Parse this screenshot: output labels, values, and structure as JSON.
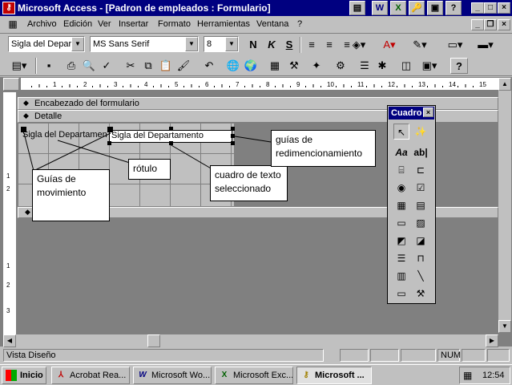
{
  "window": {
    "title": "Microsoft Access - [Padron de empleados : Formulario]",
    "app_icon": "access-key-icon",
    "title_apps": [
      "W",
      "X",
      "🔑",
      "?"
    ]
  },
  "menu": {
    "items": [
      {
        "label": "Archivo"
      },
      {
        "label": "Edición"
      },
      {
        "label": "Ver"
      },
      {
        "label": "Insertar"
      },
      {
        "label": "Formato"
      },
      {
        "label": "Herramientas"
      },
      {
        "label": "Ventana"
      },
      {
        "label": "?"
      }
    ]
  },
  "format_toolbar": {
    "object_combo": "Sigla del Depart",
    "font_combo": "MS Sans Serif",
    "size_combo": "8",
    "bold": "N",
    "italic": "K",
    "underline": "S"
  },
  "form_design": {
    "header_section": "Encabezado del formulario",
    "detail_section": "Detalle",
    "label_control_text": "Sigla del Departamen",
    "textbox_control_text": "Sigla del Departamento",
    "ruler_top_numbers": [
      "1",
      "2",
      "3",
      "4",
      "5",
      "6",
      "7",
      "8",
      "9",
      "10",
      "11",
      "12",
      "13",
      "14",
      "15"
    ],
    "ruler_left_numbers": [
      "1",
      "2",
      "1",
      "2",
      "3"
    ]
  },
  "callouts": {
    "move_guides": "Guías de movimiento",
    "label": "rótulo",
    "resize_guides": "guías de redimencionamiento",
    "selected_textbox": "cuadro de texto seleccionado"
  },
  "toolbox": {
    "title": "Cuadro",
    "close": "×"
  },
  "status": {
    "text": "Vista Diseño",
    "num": "NUM"
  },
  "taskbar": {
    "start": "Inicio",
    "tasks": [
      {
        "label": "Acrobat Rea...",
        "icon": "acrobat-icon"
      },
      {
        "label": "Microsoft Wo...",
        "icon": "word-icon"
      },
      {
        "label": "Microsoft Exc...",
        "icon": "excel-icon"
      },
      {
        "label": "Microsoft ...",
        "icon": "access-icon"
      }
    ],
    "clock": "12:54"
  }
}
